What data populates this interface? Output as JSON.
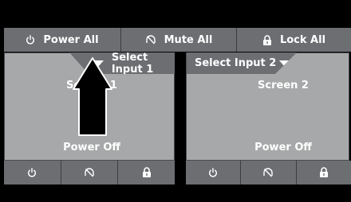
{
  "top_bar": {
    "power_all": {
      "label": "Power All",
      "icon": "power-icon"
    },
    "mute_all": {
      "label": "Mute All",
      "icon": "mute-icon"
    },
    "lock_all": {
      "label": "Lock All",
      "icon": "lock-icon"
    }
  },
  "screens": [
    {
      "select_input_label": "Select Input 1",
      "name": "Screen 1",
      "power_status": "Power Off",
      "controls": [
        "power-icon",
        "mute-icon",
        "lock-icon"
      ]
    },
    {
      "select_input_label": "Select Input 2",
      "name": "Screen 2",
      "power_status": "Power Off",
      "controls": [
        "power-icon",
        "mute-icon",
        "lock-icon"
      ]
    }
  ],
  "colors": {
    "background": "#000000",
    "bar": "#6c6e72",
    "panel": "#a7a8a9",
    "text": "#ffffff"
  }
}
